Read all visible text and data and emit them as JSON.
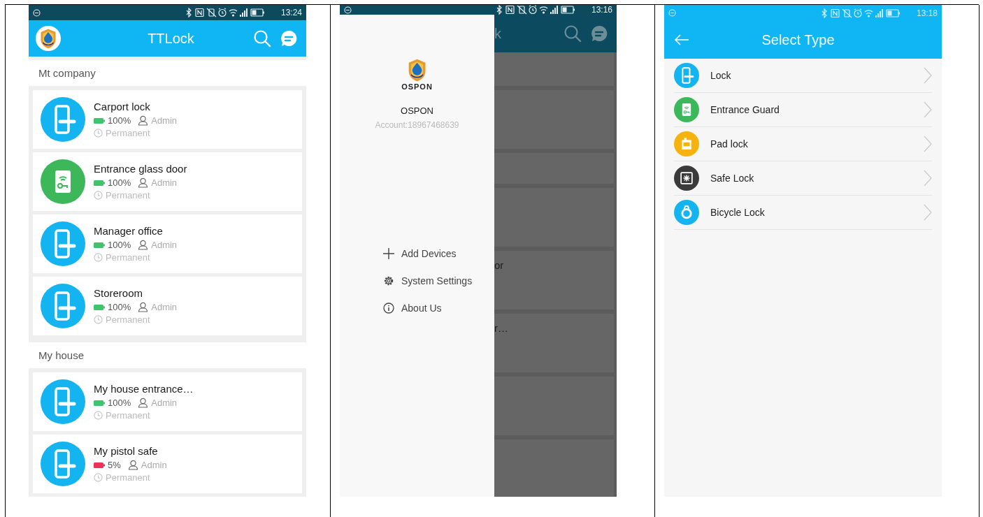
{
  "screens": [
    {
      "kind": "device_list",
      "status_bar": {
        "time": "13:24"
      },
      "app_bar": {
        "title": "TTLock"
      },
      "groups": [
        {
          "name": "Mt company",
          "devices": [
            {
              "name": "Carport lock",
              "kind": "lock",
              "battery": "100%",
              "color": "#3ec46d",
              "role": "Admin",
              "validity": "Permanent"
            },
            {
              "name": "Entrance glass door",
              "kind": "entrance_guard",
              "battery": "100%",
              "color": "#3ec46d",
              "role": "Admin",
              "validity": "Permanent"
            },
            {
              "name": "Manager office",
              "kind": "lock",
              "battery": "100%",
              "color": "#3ec46d",
              "role": "Admin",
              "validity": "Permanent"
            },
            {
              "name": "Storeroom",
              "kind": "lock",
              "battery": "100%",
              "color": "#3ec46d",
              "role": "Admin",
              "validity": "Permanent"
            }
          ]
        },
        {
          "name": "My house",
          "devices": [
            {
              "name": "My house entrance…",
              "kind": "lock",
              "battery": "100%",
              "color": "#3ec46d",
              "role": "Admin",
              "validity": "Permanent"
            },
            {
              "name": "My pistol safe",
              "kind": "lock",
              "battery": "5%",
              "color": "#f0305a",
              "role": "Admin",
              "validity": "Permanent"
            }
          ]
        }
      ]
    },
    {
      "kind": "drawer",
      "status_bar": {
        "time": "13:16"
      },
      "drawer": {
        "logo_text": "OSPON",
        "brand": "OSPON",
        "account": "Account:18967468639",
        "menu": [
          {
            "label": "Add Devices",
            "kind": "add"
          },
          {
            "label": "System Settings",
            "kind": "settings"
          },
          {
            "label": "About Us",
            "kind": "about"
          }
        ]
      },
      "background": {
        "title_fragment": "k",
        "rows": [
          {
            "kind": "header"
          },
          {
            "kind": "card"
          },
          {
            "kind": "header"
          },
          {
            "kind": "card"
          },
          {
            "kind": "card",
            "text": "or"
          },
          {
            "kind": "card",
            "text": "r…"
          },
          {
            "kind": "card"
          },
          {
            "kind": "card"
          }
        ]
      }
    },
    {
      "kind": "select_type",
      "status_bar": {
        "time": "13:18"
      },
      "app_bar": {
        "title": "Select Type"
      },
      "types": [
        {
          "label": "Lock",
          "kind": "lock",
          "color": "#14b4f0"
        },
        {
          "label": "Entrance Guard",
          "kind": "entrance_guard",
          "color": "#3cb85a"
        },
        {
          "label": "Pad lock",
          "kind": "pad_lock",
          "color": "#f6b20e"
        },
        {
          "label": "Safe Lock",
          "kind": "safe",
          "color": "#3a3a3a"
        },
        {
          "label": "Bicycle Lock",
          "kind": "bicycle",
          "color": "#14b4f0"
        }
      ]
    }
  ]
}
